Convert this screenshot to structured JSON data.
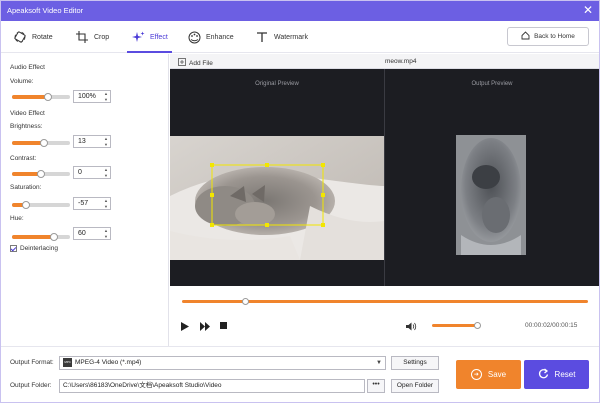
{
  "window": {
    "title": "Apeaksoft Video Editor",
    "close_glyph": "✕"
  },
  "tabs": [
    {
      "label": "Rotate",
      "icon": "rotate-icon"
    },
    {
      "label": "Crop",
      "icon": "crop-icon"
    },
    {
      "label": "Effect",
      "icon": "effect-sparkle-icon",
      "active": true
    },
    {
      "label": "Enhance",
      "icon": "enhance-palette-icon"
    },
    {
      "label": "Watermark",
      "icon": "watermark-t-icon"
    }
  ],
  "back_button": {
    "label": "Back to Home",
    "icon": "home-icon"
  },
  "audio_effect": {
    "heading": "Audio Effect",
    "volume": {
      "label": "Volume:",
      "value": "100%",
      "level": 0.6
    }
  },
  "video_effect": {
    "heading": "Video Effect",
    "brightness": {
      "label": "Brightness:",
      "value": "13",
      "level": 0.55
    },
    "contrast": {
      "label": "Contrast:",
      "value": "0",
      "level": 0.5
    },
    "saturation": {
      "label": "Saturation:",
      "value": "-57",
      "level": 0.22
    },
    "hue": {
      "label": "Hue:",
      "value": "60",
      "level": 0.72
    }
  },
  "deinterlacing": {
    "label": "Deinterlacing",
    "checked": true
  },
  "preview": {
    "add_file": "Add File",
    "file_name": "meow.mp4",
    "original_caption": "Original Preview",
    "output_caption": "Output Preview"
  },
  "playback": {
    "time": "00:00:02/00:00:15",
    "progress": 0.14,
    "volume_level": 1.0
  },
  "output": {
    "format_label": "Output Format:",
    "format_value": "MPEG-4 Video (*.mp4)",
    "format_badge": "MP4",
    "settings_label": "Settings",
    "folder_label": "Output Folder:",
    "folder_value": "C:\\Users\\86183\\OneDrive\\文档\\Apeaksoft Studio\\Video",
    "browse_label": "•••",
    "open_folder_label": "Open Folder"
  },
  "actions": {
    "save_label": "Save",
    "reset_label": "Reset"
  },
  "colors": {
    "accent": "#6c5fe3",
    "orange": "#f0842c",
    "preview_bg": "#1c1d22",
    "crop_box": "#f2e600"
  }
}
